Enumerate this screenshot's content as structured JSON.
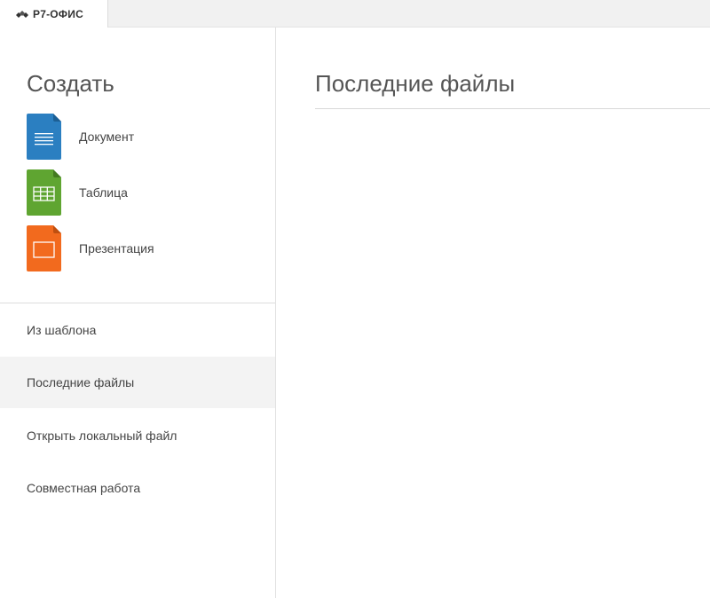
{
  "app": {
    "brand": "Р7-ОФИС",
    "logo_icon": "diamonds-logo-icon"
  },
  "colors": {
    "document": "#2b7fc1",
    "spreadsheet": "#5fa531",
    "presentation": "#f26a1e",
    "active_item_bg": "#f3f3f3"
  },
  "sidebar": {
    "create_title": "Создать",
    "create_items": [
      {
        "label": "Документ",
        "icon": "document-icon"
      },
      {
        "label": "Таблица",
        "icon": "spreadsheet-icon"
      },
      {
        "label": "Презентация",
        "icon": "presentation-icon"
      }
    ],
    "menu_items": [
      {
        "label": "Из шаблона",
        "active": false
      },
      {
        "label": "Последние файлы",
        "active": true
      },
      {
        "label": "Открыть локальный файл",
        "active": false
      },
      {
        "label": "Совместная работа",
        "active": false
      }
    ]
  },
  "main": {
    "title": "Последние файлы"
  }
}
